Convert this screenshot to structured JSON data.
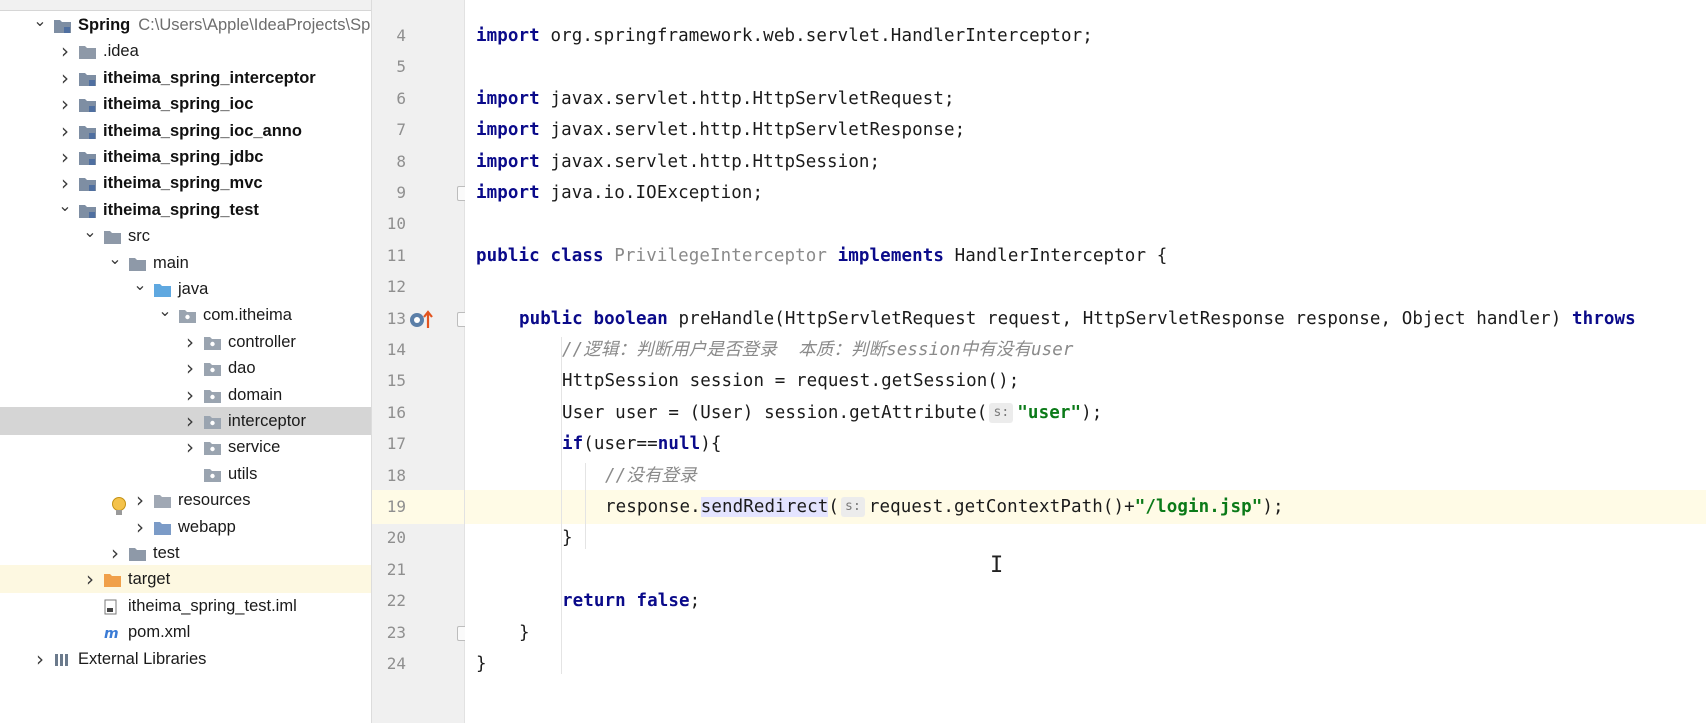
{
  "project": {
    "nodes": [
      {
        "label": "Spring",
        "path": "C:\\Users\\Apple\\IdeaProjects\\Spr",
        "depth": 0,
        "arrow": "down",
        "icon": "module-folder",
        "bold": true
      },
      {
        "label": ".idea",
        "depth": 1,
        "arrow": "right",
        "icon": "folder"
      },
      {
        "label": "itheima_spring_interceptor",
        "depth": 1,
        "arrow": "right",
        "icon": "module-folder",
        "bold": true
      },
      {
        "label": "itheima_spring_ioc",
        "depth": 1,
        "arrow": "right",
        "icon": "module-folder",
        "bold": true
      },
      {
        "label": "itheima_spring_ioc_anno",
        "depth": 1,
        "arrow": "right",
        "icon": "module-folder",
        "bold": true
      },
      {
        "label": "itheima_spring_jdbc",
        "depth": 1,
        "arrow": "right",
        "icon": "module-folder",
        "bold": true
      },
      {
        "label": "itheima_spring_mvc",
        "depth": 1,
        "arrow": "right",
        "icon": "module-folder",
        "bold": true
      },
      {
        "label": "itheima_spring_test",
        "depth": 1,
        "arrow": "down",
        "icon": "module-folder",
        "bold": true
      },
      {
        "label": "src",
        "depth": 2,
        "arrow": "down",
        "icon": "folder"
      },
      {
        "label": "main",
        "depth": 3,
        "arrow": "down",
        "icon": "folder"
      },
      {
        "label": "java",
        "depth": 4,
        "arrow": "down",
        "icon": "source-folder"
      },
      {
        "label": "com.itheima",
        "depth": 5,
        "arrow": "down",
        "icon": "package"
      },
      {
        "label": "controller",
        "depth": 6,
        "arrow": "right",
        "icon": "package"
      },
      {
        "label": "dao",
        "depth": 6,
        "arrow": "right",
        "icon": "package"
      },
      {
        "label": "domain",
        "depth": 6,
        "arrow": "right",
        "icon": "package"
      },
      {
        "label": "interceptor",
        "depth": 6,
        "arrow": "right",
        "icon": "package",
        "selected": true
      },
      {
        "label": "service",
        "depth": 6,
        "arrow": "right",
        "icon": "package"
      },
      {
        "label": "utils",
        "depth": 6,
        "arrow": "none",
        "icon": "package"
      },
      {
        "label": "resources",
        "depth": 4,
        "arrow": "right",
        "icon": "resources-folder"
      },
      {
        "label": "webapp",
        "depth": 4,
        "arrow": "right",
        "icon": "web-folder"
      },
      {
        "label": "test",
        "depth": 3,
        "arrow": "right",
        "icon": "folder"
      },
      {
        "label": "target",
        "depth": 2,
        "arrow": "right",
        "icon": "excluded-folder",
        "highlight": true
      },
      {
        "label": "itheima_spring_test.iml",
        "depth": 2,
        "arrow": "none",
        "icon": "iml-file"
      },
      {
        "label": "pom.xml",
        "depth": 2,
        "arrow": "none",
        "icon": "maven-file"
      },
      {
        "label": "External Libraries",
        "depth": 0,
        "arrow": "right",
        "icon": "libraries"
      }
    ]
  },
  "editor": {
    "lines": [
      {
        "n": "4",
        "indent": 0,
        "tokens": [
          {
            "t": "import",
            "c": "kw"
          },
          {
            "t": " org.springframework.web.servlet.HandlerInterceptor;"
          }
        ]
      },
      {
        "n": "5",
        "indent": 0,
        "tokens": []
      },
      {
        "n": "6",
        "indent": 0,
        "tokens": [
          {
            "t": "import",
            "c": "kw"
          },
          {
            "t": " javax.servlet.http.HttpServletRequest;"
          }
        ]
      },
      {
        "n": "7",
        "indent": 0,
        "tokens": [
          {
            "t": "import",
            "c": "kw"
          },
          {
            "t": " javax.servlet.http.HttpServletResponse;"
          }
        ]
      },
      {
        "n": "8",
        "indent": 0,
        "tokens": [
          {
            "t": "import",
            "c": "kw"
          },
          {
            "t": " javax.servlet.http.HttpSession;"
          }
        ]
      },
      {
        "n": "9",
        "indent": 0,
        "tokens": [
          {
            "t": "import",
            "c": "kw"
          },
          {
            "t": " java.io.IOException;"
          }
        ]
      },
      {
        "n": "10",
        "indent": 0,
        "tokens": []
      },
      {
        "n": "11",
        "indent": 0,
        "tokens": [
          {
            "t": "public class ",
            "c": "kw"
          },
          {
            "t": "PrivilegeInterceptor",
            "c": "cls"
          },
          {
            "t": " "
          },
          {
            "t": "implements",
            "c": "kw"
          },
          {
            "t": " HandlerInterceptor {"
          }
        ]
      },
      {
        "n": "12",
        "indent": 0,
        "tokens": []
      },
      {
        "n": "13",
        "indent": 1,
        "tokens": [
          {
            "t": "public boolean ",
            "c": "kw"
          },
          {
            "t": "preHandle(HttpServletRequest request, HttpServletResponse response, Object handler) "
          },
          {
            "t": "throws",
            "c": "kw"
          }
        ]
      },
      {
        "n": "14",
        "indent": 2,
        "tokens": [
          {
            "t": "//逻辑：判断用户是否登录  本质：判断session中有没有user",
            "c": "cmt"
          }
        ]
      },
      {
        "n": "15",
        "indent": 2,
        "tokens": [
          {
            "t": "HttpSession session = request.getSession();"
          }
        ]
      },
      {
        "n": "16",
        "indent": 2,
        "tokens": [
          {
            "t": "User user = (User) session.getAttribute("
          },
          {
            "t": "s:",
            "c": "hint"
          },
          {
            "t": "\"user\"",
            "c": "str"
          },
          {
            "t": ");"
          }
        ]
      },
      {
        "n": "17",
        "indent": 2,
        "tokens": [
          {
            "t": "if",
            "c": "kw"
          },
          {
            "t": "(user=="
          },
          {
            "t": "null",
            "c": "kw"
          },
          {
            "t": "){"
          }
        ]
      },
      {
        "n": "18",
        "indent": 3,
        "tokens": [
          {
            "t": "//没有登录",
            "c": "cmt"
          }
        ]
      },
      {
        "n": "19",
        "indent": 3,
        "current": true,
        "tokens": [
          {
            "t": "response."
          },
          {
            "t": "sendRedirect",
            "c": "hl"
          },
          {
            "t": "("
          },
          {
            "t": "s:",
            "c": "hint"
          },
          {
            "t": "request.getContextPath()+"
          },
          {
            "t": "\"/login.jsp\"",
            "c": "str"
          },
          {
            "t": ");"
          }
        ]
      },
      {
        "n": "20",
        "indent": 2,
        "tokens": [
          {
            "t": "}"
          }
        ]
      },
      {
        "n": "21",
        "indent": 0,
        "tokens": []
      },
      {
        "n": "22",
        "indent": 2,
        "tokens": [
          {
            "t": "return false",
            "c": "kw"
          },
          {
            "t": ";"
          }
        ]
      },
      {
        "n": "23",
        "indent": 1,
        "tokens": [
          {
            "t": "}"
          }
        ]
      },
      {
        "n": "24",
        "indent": 0,
        "tokens": [
          {
            "t": "}"
          }
        ]
      }
    ]
  },
  "colors": {
    "keyword": "#0a0a8a",
    "string": "#0b7a18",
    "comment": "#8a8a8a",
    "current_line": "#fffbe6",
    "selection": "#d5d5d5"
  },
  "icons": {
    "gutter_line_13": "override-method-icon",
    "gutter_line_19": "lightbulb-icon"
  }
}
